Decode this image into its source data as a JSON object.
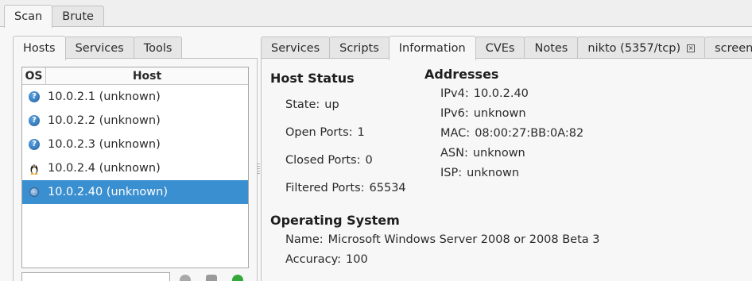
{
  "main_tabs": [
    {
      "label": "Scan",
      "active": true
    },
    {
      "label": "Brute",
      "active": false
    }
  ],
  "left_tabs": [
    {
      "label": "Hosts",
      "active": true
    },
    {
      "label": "Services",
      "active": false
    },
    {
      "label": "Tools",
      "active": false
    }
  ],
  "host_table": {
    "headers": {
      "os": "OS",
      "host": "Host"
    },
    "rows": [
      {
        "os_icon": "question-icon",
        "host": "10.0.2.1 (unknown)",
        "selected": false
      },
      {
        "os_icon": "question-icon",
        "host": "10.0.2.2 (unknown)",
        "selected": false
      },
      {
        "os_icon": "question-icon",
        "host": "10.0.2.3 (unknown)",
        "selected": false
      },
      {
        "os_icon": "linux-penguin-icon",
        "host": "10.0.2.4 (unknown)",
        "selected": false
      },
      {
        "os_icon": "windows-icon",
        "host": "10.0.2.40 (unknown)",
        "selected": true
      }
    ]
  },
  "right_tabs": [
    {
      "label": "Services",
      "active": false
    },
    {
      "label": "Scripts",
      "active": false
    },
    {
      "label": "Information",
      "active": true
    },
    {
      "label": "CVEs",
      "active": false
    },
    {
      "label": "Notes",
      "active": false
    },
    {
      "label": "nikto (5357/tcp)",
      "active": false,
      "closable": true
    },
    {
      "label": "screensh",
      "active": false
    }
  ],
  "host_status": {
    "title": "Host Status",
    "state_label": "State:",
    "state": "up",
    "open_ports_label": "Open Ports:",
    "open_ports": "1",
    "closed_ports_label": "Closed Ports:",
    "closed_ports": "0",
    "filtered_ports_label": "Filtered Ports:",
    "filtered_ports": "65534"
  },
  "addresses": {
    "title": "Addresses",
    "ipv4_label": "IPv4:",
    "ipv4": "10.0.2.40",
    "ipv6_label": "IPv6:",
    "ipv6": "unknown",
    "mac_label": "MAC:",
    "mac": "08:00:27:BB:0A:82",
    "asn_label": "ASN:",
    "asn": "unknown",
    "isp_label": "ISP:",
    "isp": "unknown"
  },
  "operating_system": {
    "title": "Operating System",
    "name_label": "Name:",
    "name": "Microsoft Windows Server 2008 or 2008 Beta 3",
    "accuracy_label": "Accuracy:",
    "accuracy": "100"
  },
  "colors": {
    "selection": "#3a8fd0",
    "background": "#efefef"
  }
}
